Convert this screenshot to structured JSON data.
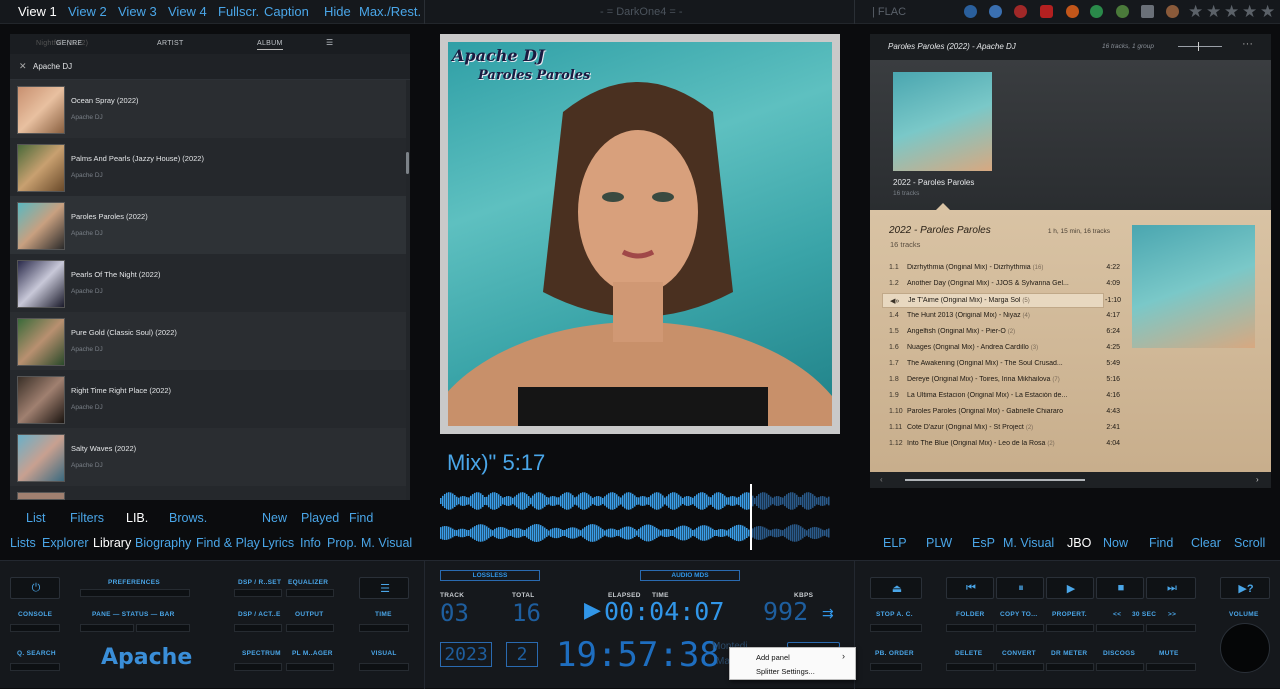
{
  "topbar": {
    "tabs": [
      "View 1",
      "View 2",
      "View 3",
      "View 4",
      "Fullscr.",
      "Caption",
      "Hide",
      "Max./Rest."
    ],
    "active_tab": "View 1",
    "brand": "- = DarkOne4 = -",
    "format": "| FLAC",
    "rating_stars": 5,
    "accent": "#4aa6e8"
  },
  "library": {
    "tabs": {
      "genre": "GENRE",
      "artist": "ARTIST",
      "album": "ALBUM"
    },
    "ghost_title": "Nightfall (2022)",
    "filter": "Apache DJ",
    "albums": [
      {
        "title": "Ocean Spray (2022)",
        "artist": "Apache DJ"
      },
      {
        "title": "Palms And Pearls (Jazzy House) (2022)",
        "artist": "Apache DJ"
      },
      {
        "title": "Paroles Paroles (2022)",
        "artist": "Apache DJ"
      },
      {
        "title": "Pearls Of The Night (2022)",
        "artist": "Apache DJ"
      },
      {
        "title": "Pure Gold (Classic Soul) (2022)",
        "artist": "Apache DJ"
      },
      {
        "title": "Right Time Right Place (2022)",
        "artist": "Apache DJ"
      },
      {
        "title": "Salty Waves (2022)",
        "artist": "Apache DJ"
      }
    ]
  },
  "cover": {
    "line1": "Apache DJ",
    "line2": "Paroles Paroles"
  },
  "now_playing_scroll": "Mix)\" 5:17",
  "playlist": {
    "header": "Paroles Paroles (2022) - Apache DJ",
    "header_meta": "16 tracks,  1 group",
    "art_title": "2022 - Paroles Paroles",
    "art_sub": "16 tracks",
    "group_title": "2022 - Paroles Paroles",
    "group_sub": "16 tracks",
    "group_meta": "1 h, 15 min,  16 tracks",
    "tracks": [
      {
        "no": "1.1",
        "name": "Dizrhythmia (Original Mix) - Dizrhythmia",
        "count": "(16)",
        "dur": "4:22"
      },
      {
        "no": "1.2",
        "name": "Another Day (Original Mix) - JJOS & Sylvanna Gel...",
        "count": "",
        "dur": "4:09"
      },
      {
        "no": "◀»",
        "name": "Je T'Aime (Original Mix) - Marga Sol",
        "count": "(5)",
        "dur": "-1:10"
      },
      {
        "no": "1.4",
        "name": "The Hunt 2013 (Original Mix) - Niyaz",
        "count": "(4)",
        "dur": "4:17"
      },
      {
        "no": "1.5",
        "name": "Angelfish (Original Mix) - Pier-O",
        "count": "(2)",
        "dur": "6:24"
      },
      {
        "no": "1.6",
        "name": "Nuages (Original Mix) - Andrea Cardillo",
        "count": "(3)",
        "dur": "4:25"
      },
      {
        "no": "1.7",
        "name": "The Awakening (Original Mix) - The Soul Crusad...",
        "count": "",
        "dur": "5:49"
      },
      {
        "no": "1.8",
        "name": "Dereye (Original Mix) - Toires, Irina Mikhailova",
        "count": "(7)",
        "dur": "5:16"
      },
      {
        "no": "1.9",
        "name": "La Ultima Estacion (Original Mix) - La Estación de...",
        "count": "",
        "dur": "4:16"
      },
      {
        "no": "1.10",
        "name": "Paroles Paroles (Original Mix) - Gabrielle Chiararo",
        "count": "",
        "dur": "4:43"
      },
      {
        "no": "1.11",
        "name": "Cote D'azur (Original Mix) - St Project",
        "count": "(2)",
        "dur": "2:41"
      },
      {
        "no": "1.12",
        "name": "Into The Blue (Original Mix) - Leo de la Rosa",
        "count": "(2)",
        "dur": "4:04"
      }
    ]
  },
  "left_tabs_row1": [
    "List",
    "Filters",
    "LIB.",
    "Brows.",
    "New",
    "Played",
    "Find"
  ],
  "left_tabs_row1_active": "LIB.",
  "left_tabs_row2": [
    "Lists",
    "Explorer",
    "Library",
    "Biography",
    "Find & Play",
    "Lyrics",
    "Info",
    "Prop.",
    "M. Visual"
  ],
  "left_tabs_row2_active": "Library",
  "right_tabs": [
    "ELP",
    "PLW",
    "EsP",
    "M. Visual",
    "JBO",
    "Now",
    "Find",
    "Clear",
    "Scroll"
  ],
  "right_tabs_active": "JBO",
  "controls": {
    "left_labels": [
      "PREFERENCES",
      "DSP / R..SET",
      "EQUALIZER",
      "CONSOLE",
      "PANE — STATUS — BAR",
      "DSP / ACT..E",
      "OUTPUT",
      "TIME",
      "Q. SEARCH",
      "SPECTRUM",
      "PL M..AGER",
      "VISUAL"
    ],
    "artist_big": "Apache",
    "lossless": "LOSSLESS",
    "audio_mode": "AUDIO MDS",
    "track_label": "TRACK",
    "track_value": "03",
    "total_label": "TOTAL",
    "total_value": "16",
    "elapsed_label": "ELAPSED",
    "time_label": "TIME",
    "elapsed_value": "00:04:07",
    "kbps_label": "KBPS",
    "kbps_value": "992",
    "year": "2023",
    "disc": "2",
    "clock": "19:57:38",
    "day": "Montedi",
    "day2": "Ma",
    "right_labels": [
      "STOP A. C.",
      "FOLDER",
      "COPY TO...",
      "PROPERT.",
      "<<",
      "30 SEC",
      ">>",
      "VOLUME",
      "PB. ORDER",
      "DELETE",
      "CONVERT",
      "DR METER",
      "DISCOGS",
      "MUTE"
    ]
  },
  "context_menu": {
    "items": [
      "Add panel",
      "Splitter Settings..."
    ]
  }
}
